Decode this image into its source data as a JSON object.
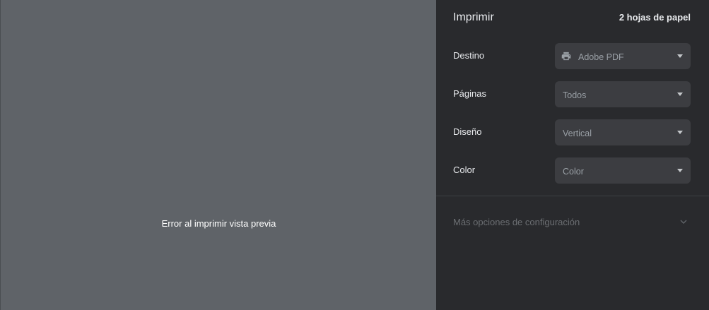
{
  "preview": {
    "error_text": "Error al imprimir vista previa"
  },
  "panel": {
    "title": "Imprimir",
    "sheet_count": "2 hojas de papel",
    "destination": {
      "label": "Destino",
      "value": "Adobe PDF",
      "icon": "printer-icon"
    },
    "pages": {
      "label": "Páginas",
      "value": "Todos"
    },
    "layout": {
      "label": "Diseño",
      "value": "Vertical"
    },
    "color": {
      "label": "Color",
      "value": "Color"
    },
    "more_options": {
      "label": "Más opciones de configuración",
      "icon": "chevron-down-icon"
    }
  },
  "colors": {
    "preview_bg": "#5f6368",
    "panel_bg": "#292a2d",
    "select_bg": "#3c3d41",
    "text_primary": "#e8eaed",
    "text_muted": "#9aa0a6"
  }
}
